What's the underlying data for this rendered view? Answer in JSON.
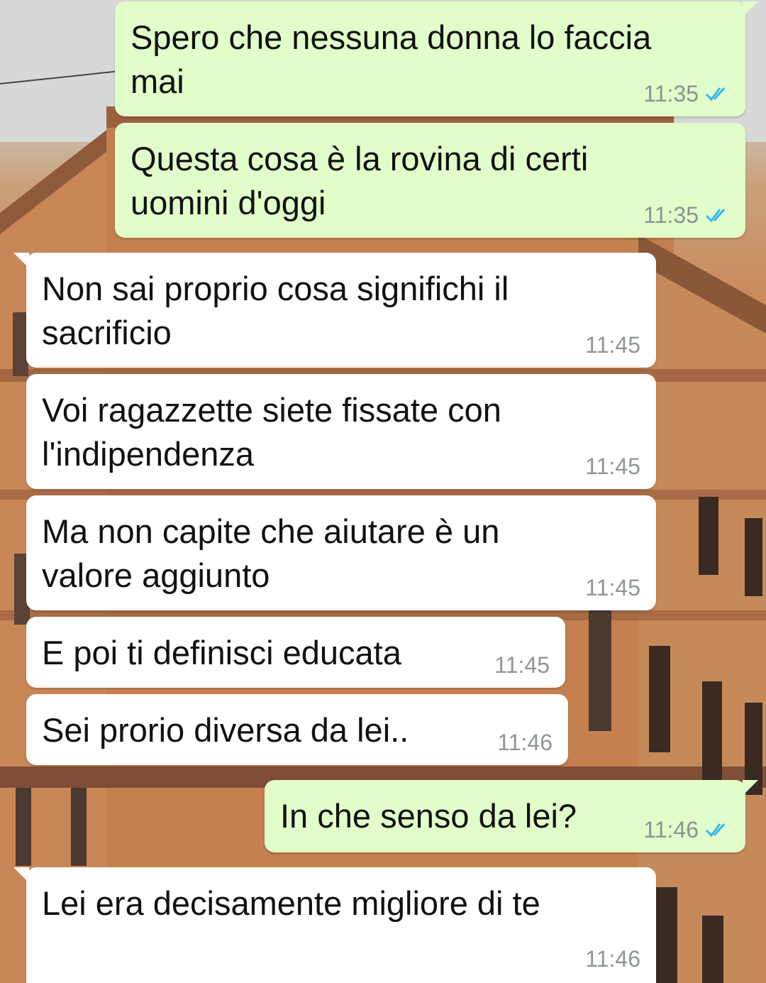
{
  "chat": {
    "messages": [
      {
        "id": "m1",
        "direction": "out",
        "text_lines": [
          "Spero che nessuna donna lo faccia",
          "mai"
        ],
        "time": "11:35",
        "read": true
      },
      {
        "id": "m2",
        "direction": "out",
        "text_lines": [
          "Questa cosa è la rovina di certi",
          "uomini d'oggi"
        ],
        "time": "11:35",
        "read": true
      },
      {
        "id": "m3",
        "direction": "in",
        "text_lines": [
          "Non sai proprio cosa significhi il",
          "sacrificio"
        ],
        "time": "11:45"
      },
      {
        "id": "m4",
        "direction": "in",
        "text_lines": [
          "Voi ragazzette siete fissate con",
          "l'indipendenza"
        ],
        "time": "11:45"
      },
      {
        "id": "m5",
        "direction": "in",
        "text_lines": [
          "Ma non capite che aiutare è un",
          "valore aggiunto"
        ],
        "time": "11:45"
      },
      {
        "id": "m6",
        "direction": "in",
        "text_lines": [
          "E poi ti definisci educata"
        ],
        "time": "11:45"
      },
      {
        "id": "m7",
        "direction": "in",
        "text_lines": [
          "Sei prorio diversa da lei.."
        ],
        "time": "11:46"
      },
      {
        "id": "m8",
        "direction": "out",
        "text_lines": [
          "In che senso da lei?"
        ],
        "time": "11:46",
        "read": true
      },
      {
        "id": "m9",
        "direction": "in",
        "text_lines": [
          "Lei era decisamente migliore di te"
        ],
        "time": "11:46"
      }
    ]
  },
  "colors": {
    "outgoing_bubble": "#e1fdc9",
    "incoming_bubble": "#ffffff",
    "read_ticks": "#34b7f1",
    "timestamp": "#8a948f"
  },
  "icons": {
    "read_receipt": "double-check-icon",
    "background": "building-wallpaper"
  }
}
